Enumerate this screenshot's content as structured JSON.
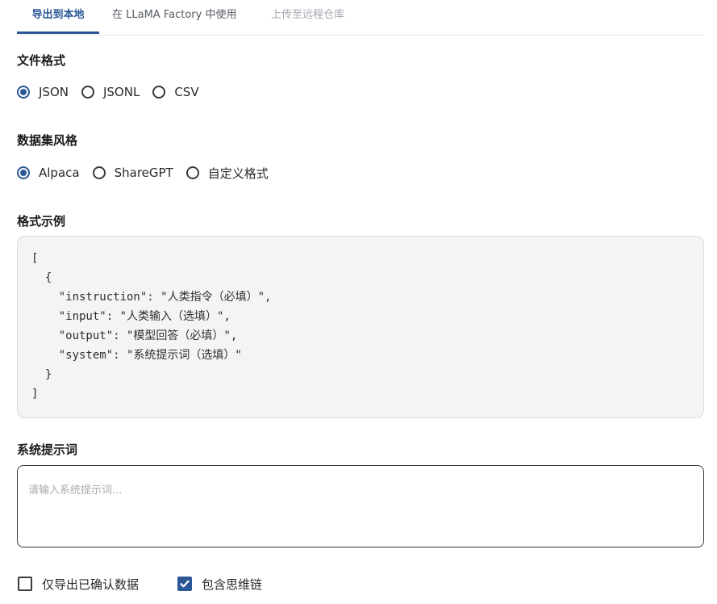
{
  "tabs": [
    {
      "label": "导出到本地",
      "active": true
    },
    {
      "label": "在 LLaMA Factory 中使用",
      "active": false
    },
    {
      "label": "上传至远程仓库",
      "active": false
    }
  ],
  "file_format": {
    "heading": "文件格式",
    "options": [
      "JSON",
      "JSONL",
      "CSV"
    ],
    "selected": "JSON"
  },
  "dataset_style": {
    "heading": "数据集风格",
    "options": [
      "Alpaca",
      "ShareGPT",
      "自定义格式"
    ],
    "selected": "Alpaca"
  },
  "format_example": {
    "heading": "格式示例",
    "code": "[\n  {\n    \"instruction\": \"人类指令（必填）\",\n    \"input\": \"人类输入（选填）\",\n    \"output\": \"模型回答（必填）\",\n    \"system\": \"系统提示词（选填）\"\n  }\n]"
  },
  "system_prompt": {
    "heading": "系统提示词",
    "placeholder": "请输入系统提示词...",
    "value": ""
  },
  "checkboxes": [
    {
      "label": "仅导出已确认数据",
      "checked": false
    },
    {
      "label": "包含思维链",
      "checked": true
    }
  ],
  "colors": {
    "accent": "#2b5797",
    "code_background": "#f4f4f4",
    "disabled_tab": "#a2a6ae"
  }
}
